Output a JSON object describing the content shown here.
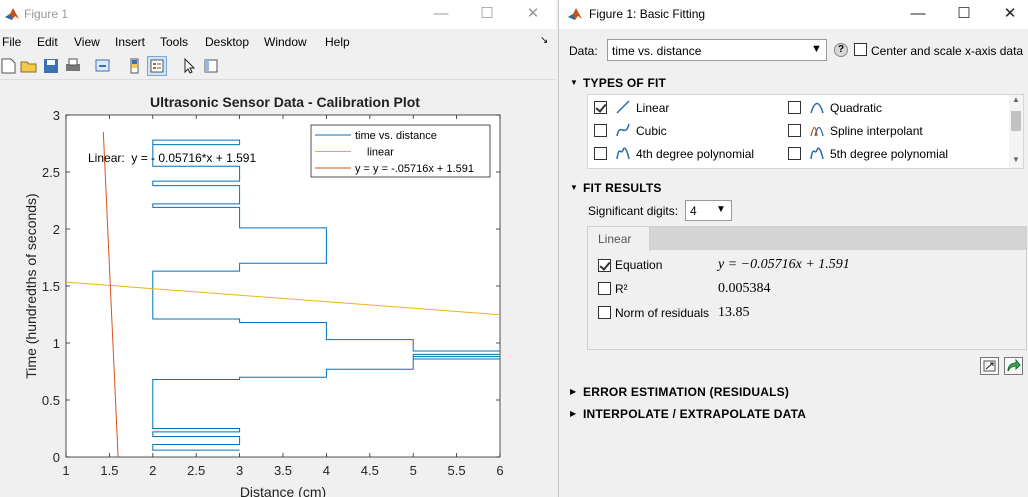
{
  "figure": {
    "title": "Figure 1",
    "menus": [
      "File",
      "Edit",
      "View",
      "Insert",
      "Tools",
      "Desktop",
      "Window",
      "Help"
    ],
    "toolbar_icons": [
      "new-figure-icon",
      "open-icon",
      "save-icon",
      "print-icon",
      "link-icon",
      "colorbar-icon",
      "legend-icon",
      "pointer-icon",
      "property-editor-icon"
    ],
    "dock_arrow": "↘"
  },
  "chart_data": {
    "type": "line",
    "title": "Ultrasonic Sensor Data - Calibration Plot",
    "xlabel": "Distance (cm)",
    "ylabel": "Time (hundredths of seconds)",
    "xlim": [
      1,
      6
    ],
    "ylim": [
      0,
      3
    ],
    "xticks": [
      "1",
      "1.5",
      "2",
      "2.5",
      "3",
      "3.5",
      "4",
      "4.5",
      "5",
      "5.5",
      "6"
    ],
    "yticks": [
      "0",
      "0.5",
      "1",
      "1.5",
      "2",
      "2.5",
      "3"
    ],
    "annotation": "Linear:  y = - 0.05716*x + 1.591",
    "legend_position": "top-right",
    "series": [
      {
        "name": "time vs. distance",
        "color": "#0072bd",
        "x": [
          2,
          2,
          3,
          3,
          2,
          2,
          3,
          3,
          2,
          2,
          3,
          3,
          2,
          2,
          3,
          3,
          4,
          4,
          3,
          3,
          2,
          2,
          3,
          3,
          4,
          4,
          5,
          5,
          6,
          6,
          5,
          5,
          6,
          6,
          5,
          5,
          4,
          4,
          3,
          3,
          2,
          2,
          3,
          3,
          2,
          2,
          3,
          3,
          2,
          2,
          3
        ],
        "y": [
          2.76,
          2.74,
          2.74,
          2.78,
          2.78,
          2.55,
          2.55,
          2.42,
          2.42,
          2.38,
          2.38,
          2.22,
          2.22,
          2.19,
          2.19,
          2.01,
          2.01,
          1.7,
          1.7,
          1.63,
          1.63,
          1.21,
          1.21,
          1.18,
          1.18,
          1.03,
          1.03,
          0.93,
          0.93,
          0.88,
          0.88,
          0.86,
          0.86,
          0.9,
          0.9,
          0.77,
          0.77,
          0.7,
          0.7,
          0.68,
          0.68,
          0.25,
          0.25,
          0.22,
          0.22,
          0.18,
          0.18,
          0.11,
          0.11,
          0.06,
          0.06
        ]
      },
      {
        "name": "linear",
        "color": "#edb120",
        "x": [
          1,
          6
        ],
        "y": [
          1.534,
          1.248
        ]
      },
      {
        "name": "y = y = -.05716x + 1.591",
        "color": "#d95319",
        "x": [
          1.43,
          1.6
        ],
        "y": [
          2.85,
          0
        ]
      }
    ]
  },
  "basic_fitting": {
    "title": "Figure 1: Basic Fitting",
    "data_label": "Data:",
    "data_value": "time vs. distance",
    "help_icon": "?",
    "center_scale_label": "Center and scale x-axis data",
    "types_header": "TYPES OF FIT",
    "fit_types": [
      {
        "label": "Linear",
        "checked": true,
        "icon": "line-icon"
      },
      {
        "label": "Quadratic",
        "checked": false,
        "icon": "parabola-icon"
      },
      {
        "label": "Cubic",
        "checked": false,
        "icon": "cubic-icon"
      },
      {
        "label": "Spline interpolant",
        "checked": false,
        "icon": "spline-icon"
      },
      {
        "label": "4th degree polynomial",
        "checked": false,
        "icon": "poly-icon"
      },
      {
        "label": "5th degree polynomial",
        "checked": false,
        "icon": "poly-icon"
      }
    ],
    "results_header": "FIT RESULTS",
    "sig_digits_label": "Significant digits:",
    "sig_digits_value": "4",
    "results_tab": "Linear",
    "results": [
      {
        "label": "Equation",
        "checked": true,
        "value": "y = −0.05716x + 1.591"
      },
      {
        "label": "R²",
        "checked": false,
        "value": "0.005384"
      },
      {
        "label": "Norm of residuals",
        "checked": false,
        "value": "13.85"
      }
    ],
    "error_header": "ERROR ESTIMATION (RESIDUALS)",
    "interp_header": "INTERPOLATE / EXTRAPOLATE DATA"
  }
}
